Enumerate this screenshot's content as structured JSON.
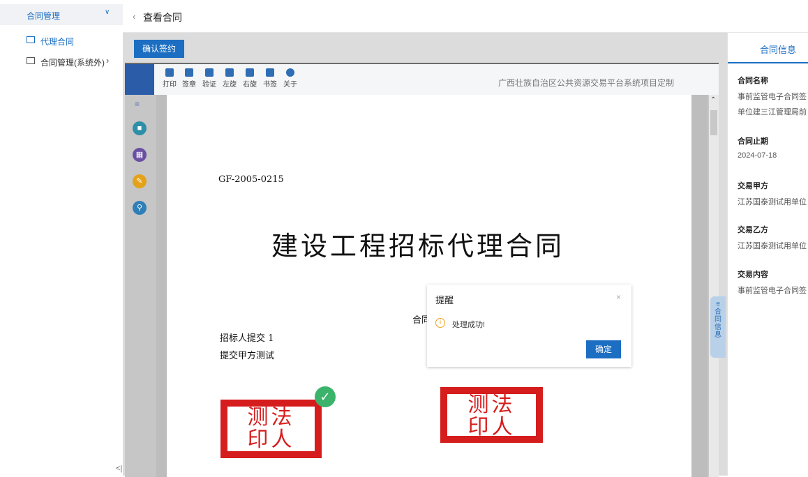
{
  "sidebar": {
    "group_label": "合同管理",
    "items": [
      {
        "label": "代理合同"
      },
      {
        "label": "合同管理(系统外)"
      }
    ],
    "collapse_glyph": "<|"
  },
  "header": {
    "back_glyph": "‹",
    "title": "查看合同"
  },
  "main": {
    "confirm_label": "确认签约"
  },
  "toolbar": {
    "items": [
      {
        "label": "打印",
        "icon": "print-icon"
      },
      {
        "label": "签章",
        "icon": "stamp-icon"
      },
      {
        "label": "验证",
        "icon": "verify-icon"
      },
      {
        "label": "左旋",
        "icon": "rotate-left-icon"
      },
      {
        "label": "右旋",
        "icon": "rotate-right-icon"
      },
      {
        "label": "书签",
        "icon": "bookmark-icon"
      },
      {
        "label": "关于",
        "icon": "about-icon"
      }
    ],
    "brand": "广西壮族自治区公共资源交易平台系统项目定制"
  },
  "document": {
    "code": "GF-2005-0215",
    "title": "建设工程招标代理合同",
    "line1": "招标人提交 1",
    "line2": "提交甲方测试",
    "mid_text": "合同",
    "stamp_row1": "测法",
    "stamp_row2": "印人"
  },
  "float_tab": "≡合同信息",
  "info_panel": {
    "title": "合同信息",
    "fields": [
      {
        "label": "合同名称",
        "value": "事前监管电子合同签",
        "value2": "单位建三江管理局前"
      },
      {
        "label": "合同止期",
        "value": "2024-07-18"
      },
      {
        "label": "交易甲方",
        "value": "江苏国泰测试用单位"
      },
      {
        "label": "交易乙方",
        "value": "江苏国泰测试用单位"
      },
      {
        "label": "交易内容",
        "value": "事前监管电子合同签"
      }
    ]
  },
  "dialog": {
    "title": "提醒",
    "message": "处理成功!",
    "ok_label": "确定",
    "close_glyph": "×"
  },
  "colors": {
    "accent": "#1b6ec2",
    "stamp": "#d61d1d",
    "success": "#3bb36b"
  }
}
